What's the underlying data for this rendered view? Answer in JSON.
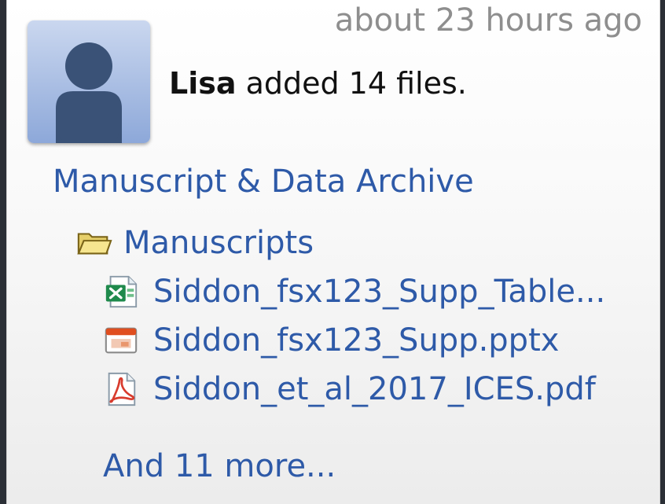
{
  "activity": {
    "timestamp": "about 23 hours ago",
    "user": "Lisa",
    "action": " added 14 files.",
    "archive_name": "Manuscript & Data Archive"
  },
  "folder": {
    "name": "Manuscripts",
    "icon": "folder-icon"
  },
  "files": [
    {
      "name": "Siddon_fsx123_Supp_Table...",
      "icon": "excel-file-icon"
    },
    {
      "name": "Siddon_fsx123_Supp.pptx",
      "icon": "powerpoint-file-icon"
    },
    {
      "name": "Siddon_et_al_2017_ICES.pdf",
      "icon": "pdf-file-icon"
    }
  ],
  "more_link": "And 11 more...",
  "colors": {
    "link": "#2e5aa8",
    "timestamp": "#8e8e8e",
    "avatar": "#8da8d9"
  }
}
